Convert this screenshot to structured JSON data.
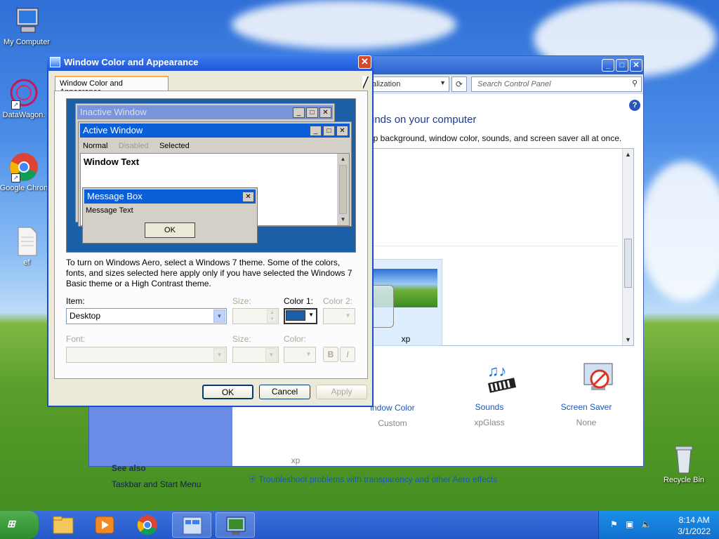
{
  "desktop": {
    "icons": [
      {
        "label": "My Computer"
      },
      {
        "label": "DataWagon."
      },
      {
        "label": "Google Chron"
      },
      {
        "label": "ef"
      },
      {
        "label": "Recycle Bin"
      }
    ]
  },
  "control_panel": {
    "address": "alization",
    "search_placeholder": "Search Control Panel",
    "heading": "unds on your computer",
    "subheading": "op background, window color, sounds, and screen saver all at once.",
    "theme_caption": "xp",
    "items": [
      {
        "name": "indow Color",
        "value": "Custom"
      },
      {
        "name": "Sounds",
        "value": "xpGlass"
      },
      {
        "name": "Screen Saver",
        "value": "None"
      }
    ],
    "left_value": "xp",
    "see_also": "See also",
    "taskbar_link": "Taskbar and Start Menu",
    "troubleshoot_link": "Troubleshoot problems with transparency and other Aero effects"
  },
  "dialog": {
    "title": "Window Color and Appearance",
    "tab": "Window Color and Appearance",
    "preview": {
      "inactive_title": "Inactive Window",
      "active_title": "Active Window",
      "menu_normal": "Normal",
      "menu_disabled": "Disabled",
      "menu_selected": "Selected",
      "window_text": "Window Text",
      "msgbox_title": "Message Box",
      "msgbox_text": "Message Text",
      "msgbox_ok": "OK"
    },
    "note": "To turn on Windows Aero, select a Windows 7 theme.  Some of the colors, fonts, and sizes selected here apply only if you have selected the Windows 7 Basic theme or a High Contrast theme.",
    "labels": {
      "item": "Item:",
      "size": "Size:",
      "color1": "Color 1:",
      "color2": "Color 2:",
      "font": "Font:",
      "size2": "Size:",
      "color": "Color:",
      "bold": "B",
      "italic": "I"
    },
    "item_value": "Desktop",
    "buttons": {
      "ok": "OK",
      "cancel": "Cancel",
      "apply": "Apply"
    }
  },
  "taskbar": {
    "time": "8:14 AM",
    "date": "3/1/2022"
  },
  "colors": {
    "desktop_color": "#1a5fa8",
    "active_title": "#0a5fd8",
    "inactive_title": "#7a96d8"
  }
}
